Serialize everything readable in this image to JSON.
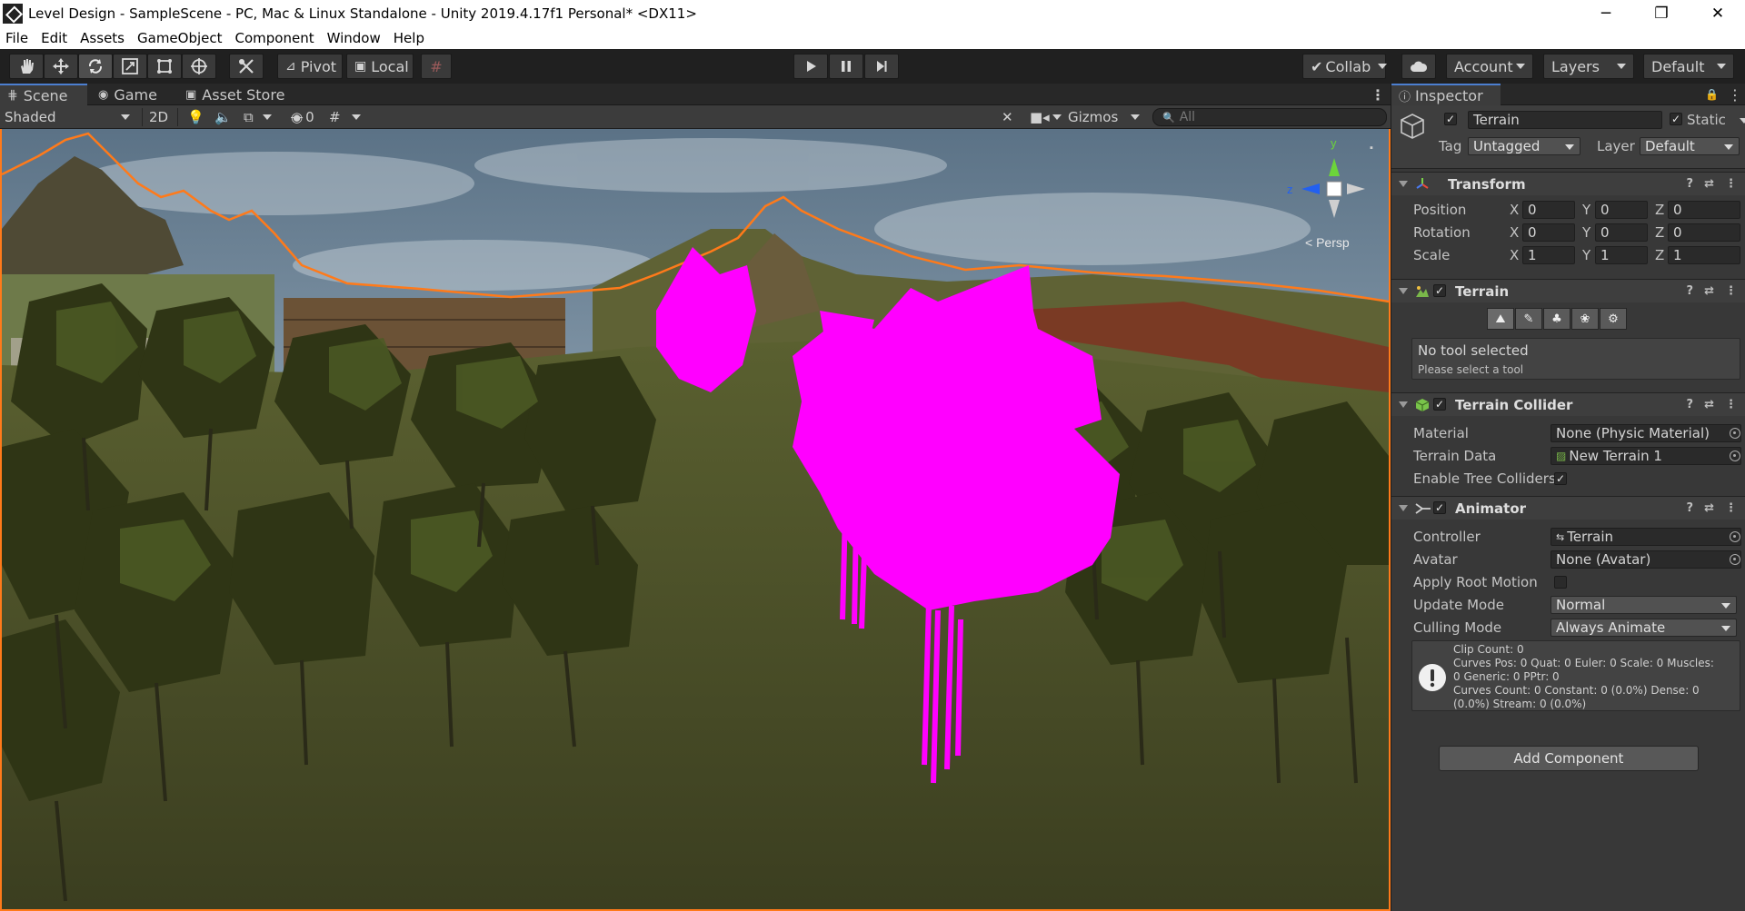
{
  "window": {
    "title": "Level Design - SampleScene - PC, Mac & Linux Standalone - Unity 2019.4.17f1 Personal* <DX11>",
    "minimize": "─",
    "restore": "❐",
    "close": "✕"
  },
  "menu": [
    "File",
    "Edit",
    "Assets",
    "GameObject",
    "Component",
    "Window",
    "Help"
  ],
  "toolbar": {
    "tools": [
      "hand-icon",
      "move-icon",
      "rotate-icon",
      "scale-icon",
      "rect-icon",
      "transform-icon",
      "custom-tool-icon"
    ],
    "pivot_label": "Pivot",
    "local_label": "Local",
    "collab_label": "Collab",
    "account_label": "Account",
    "layers_label": "Layers",
    "layout_label": "Default"
  },
  "scene_tabs": {
    "scene": "Scene",
    "game": "Game",
    "asset_store": "Asset Store"
  },
  "scene_toolbar": {
    "shading": "Shaded",
    "mode_2d": "2D",
    "hidden_count": "0",
    "gizmos": "Gizmos",
    "search_placeholder": "All"
  },
  "gizmo": {
    "y_label": "y",
    "z_label": "z",
    "persp_label": "< Persp"
  },
  "inspector": {
    "tab_label": "Inspector",
    "object_name": "Terrain",
    "static_label": "Static",
    "tag_label": "Tag",
    "tag_value": "Untagged",
    "layer_label": "Layer",
    "layer_value": "Default",
    "transform": {
      "title": "Transform",
      "position_label": "Position",
      "rotation_label": "Rotation",
      "scale_label": "Scale",
      "axis_x": "X",
      "axis_y": "Y",
      "axis_z": "Z",
      "position": [
        "0",
        "0",
        "0"
      ],
      "rotation": [
        "0",
        "0",
        "0"
      ],
      "scale": [
        "1",
        "1",
        "1"
      ]
    },
    "terrain": {
      "title": "Terrain",
      "tool_icons": [
        "raise-terrain-icon",
        "paint-brush-icon",
        "tree-icon",
        "detail-icon",
        "settings-icon"
      ],
      "help_title": "No tool selected",
      "help_text": "Please select a tool"
    },
    "collider": {
      "title": "Terrain Collider",
      "material_label": "Material",
      "material_value": "None (Physic Material)",
      "data_label": "Terrain Data",
      "data_value": "New Terrain 1",
      "enable_trees_label": "Enable Tree Colliders"
    },
    "animator": {
      "title": "Animator",
      "controller_label": "Controller",
      "controller_value": "Terrain",
      "avatar_label": "Avatar",
      "avatar_value": "None (Avatar)",
      "root_motion_label": "Apply Root Motion",
      "update_label": "Update Mode",
      "update_value": "Normal",
      "culling_label": "Culling Mode",
      "culling_value": "Always Animate",
      "info_lines": [
        "Clip Count: 0",
        "Curves Pos: 0 Quat: 0 Euler: 0 Scale: 0 Muscles:",
        "0 Generic: 0 PPtr: 0",
        "Curves Count: 0 Constant: 0 (0.0%) Dense: 0",
        "(0.0%) Stream: 0 (0.0%)"
      ]
    },
    "add_component": "Add Component"
  },
  "colors": {
    "selection_outline": "#ff7a1a",
    "missing_material": "#ff00ff",
    "editor_dark": "#383838",
    "tab_accent": "#4c7fd0"
  }
}
